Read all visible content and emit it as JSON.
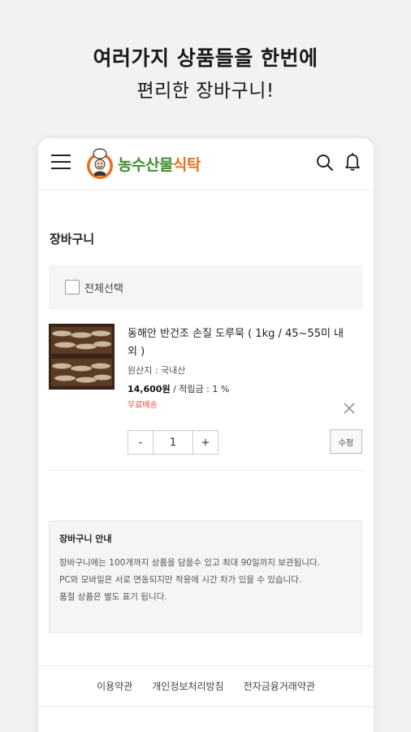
{
  "headline": {
    "line1": "여러가지 상품들을 한번에",
    "line2": "편리한 장바구니!"
  },
  "header": {
    "logo_text_green": "농수산물",
    "logo_text_orange": "식탁",
    "icons": [
      "menu-icon",
      "search-icon",
      "bell-icon"
    ]
  },
  "cart": {
    "title": "장바구니",
    "select_all_label": "전체선택",
    "item": {
      "name": "동해안 반건조 손질 도루묵 ( 1kg / 45~55미 내외 )",
      "origin": "원산지 : 국내산",
      "price": "14,600원",
      "points": " / 적립금 : 1 %",
      "shipping": "무료배송",
      "quantity": "1",
      "minus": "-",
      "plus": "+",
      "modify_label": "수정"
    }
  },
  "guide": {
    "title": "장바구니 안내",
    "lines": [
      "장바구니에는 100개까지 상품을 담을수 있고 최대 90일까지 보관됩니다.",
      "PC와 모바일은 서로 연동되지만 적용에 시간 차가 있을 수 있습니다.",
      "품절 상품은 별도 표기 됩니다."
    ]
  },
  "footer": {
    "links": [
      "이용약관",
      "개인정보처리방침",
      "전자금융거래약관"
    ]
  },
  "colors": {
    "background": "#f2f2f2",
    "logo_green": "#3f8f2e",
    "logo_orange": "#e8711f",
    "shipping_red": "#e2513b"
  }
}
